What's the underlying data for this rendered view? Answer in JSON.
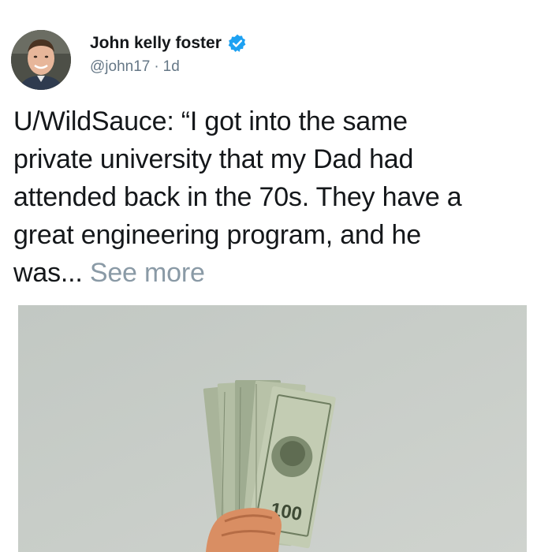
{
  "author": {
    "display_name": "John kelly foster",
    "handle": "@john17",
    "separator": "·",
    "timestamp": "1d",
    "verified_icon": "verified-badge-icon",
    "verified_color": "#1da1f2"
  },
  "tweet": {
    "lines": [
      "U/WildSauce: “I got into the same",
      "private university that my Dad had",
      "attended back in the 70s. They have a",
      "great engineering program, and he",
      "was..."
    ],
    "see_more_label": "See more"
  },
  "media": {
    "banknote_label": "100"
  }
}
